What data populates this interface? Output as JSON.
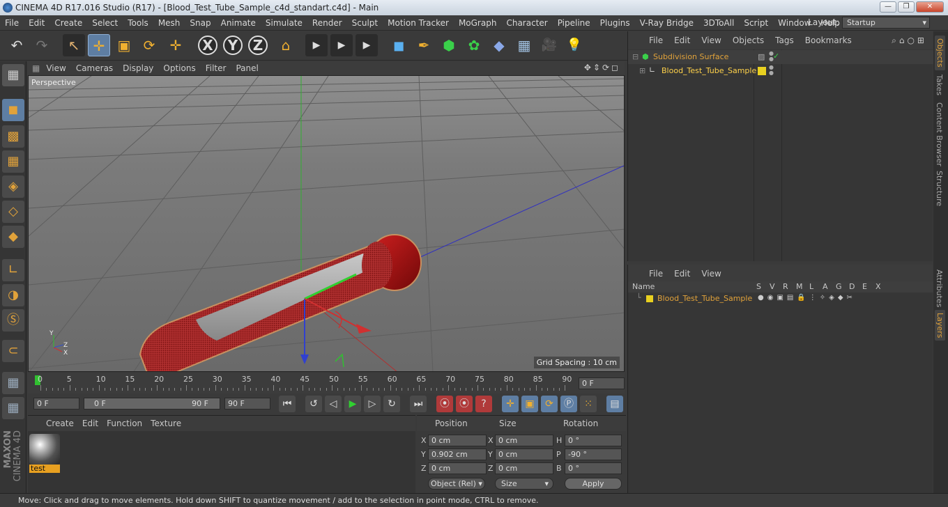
{
  "window": {
    "title": "CINEMA 4D R17.016 Studio (R17) - [Blood_Test_Tube_Sample_c4d_standart.c4d] - Main"
  },
  "menu": [
    "File",
    "Edit",
    "Create",
    "Select",
    "Tools",
    "Mesh",
    "Snap",
    "Animate",
    "Simulate",
    "Render",
    "Sculpt",
    "Motion Tracker",
    "MoGraph",
    "Character",
    "Pipeline",
    "Plugins",
    "V-Ray Bridge",
    "3DToAll",
    "Script",
    "Window",
    "Help"
  ],
  "layout": {
    "label": "Layout:",
    "value": "Startup"
  },
  "toolbar_icons": [
    "undo-icon",
    "redo-icon",
    "live-select-icon",
    "move-icon",
    "scale-icon",
    "rotate-icon",
    "transform-icon",
    "x-axis-lock",
    "y-axis-lock",
    "z-axis-lock",
    "world-coordinate-icon",
    "render-view-icon",
    "render-picture-viewer-icon",
    "edit-render-settings-icon",
    "cube-icon",
    "pen-icon",
    "subdivision-icon",
    "mograph-cloner-icon",
    "deformer-icon",
    "floor-icon",
    "camera-icon",
    "light-icon"
  ],
  "toolbar_glyphs": {
    "undo": "↶",
    "redo": "↷",
    "select": "↖",
    "move": "✛",
    "scale": "▣",
    "rotate": "⟳",
    "transform": "✛",
    "x": "X",
    "y": "Y",
    "z": "Z",
    "world": "⌂",
    "render1": "▶",
    "render2": "▶",
    "render3": "▶",
    "cube": "◼",
    "pen": "✒",
    "subdiv": "⬢",
    "cloner": "✿",
    "deformer": "◆",
    "floor": "▦",
    "camera": "🎥",
    "light": "💡"
  },
  "viewport": {
    "menu": [
      "View",
      "Cameras",
      "Display",
      "Options",
      "Filter",
      "Panel"
    ],
    "label": "Perspective",
    "grid_spacing": "Grid Spacing : 10 cm",
    "axis_labels": {
      "y": "Y",
      "z": "Z",
      "x": "X"
    }
  },
  "timeline": {
    "ticks": [
      "0",
      "5",
      "10",
      "15",
      "20",
      "25",
      "30",
      "35",
      "40",
      "45",
      "50",
      "55",
      "60",
      "65",
      "70",
      "75",
      "80",
      "85",
      "90"
    ],
    "current_frame": "0 F"
  },
  "transport": {
    "start": "0 F",
    "range_start": "0 F",
    "range_end": "90 F",
    "end": "90 F"
  },
  "material": {
    "menu": [
      "Create",
      "Edit",
      "Function",
      "Texture"
    ],
    "items": [
      {
        "name": "test"
      }
    ]
  },
  "coordinates": {
    "headers": {
      "position": "Position",
      "size": "Size",
      "rotation": "Rotation"
    },
    "rows": [
      {
        "axis": "X",
        "pos": "0 cm",
        "saxis": "X",
        "size": "0 cm",
        "raxis": "H",
        "rot": "0 °"
      },
      {
        "axis": "Y",
        "pos": "0.902 cm",
        "saxis": "Y",
        "size": "0 cm",
        "raxis": "P",
        "rot": "-90 °"
      },
      {
        "axis": "Z",
        "pos": "0 cm",
        "saxis": "Z",
        "size": "0 cm",
        "raxis": "B",
        "rot": "0 °"
      }
    ],
    "mode": "Object (Rel)",
    "size_mode": "Size",
    "apply": "Apply"
  },
  "objects": {
    "menu": [
      "File",
      "Edit",
      "View",
      "Objects",
      "Tags",
      "Bookmarks"
    ],
    "tree": [
      {
        "name": "Subdivision Surface",
        "color": "#e1a23a"
      },
      {
        "name": "Blood_Test_Tube_Sample",
        "color": "#ffd24a"
      }
    ]
  },
  "layers": {
    "menu": [
      "File",
      "Edit",
      "View"
    ],
    "columns": [
      "Name",
      "S",
      "V",
      "R",
      "M",
      "L",
      "A",
      "G",
      "D",
      "E",
      "X"
    ],
    "rows": [
      {
        "name": "Blood_Test_Tube_Sample",
        "color": "#e8d020"
      }
    ]
  },
  "side_tabs": [
    "Objects",
    "Takes",
    "Content Browser",
    "Structure",
    "Attributes",
    "Layers"
  ],
  "status": "Move: Click and drag to move elements. Hold down SHIFT to quantize movement / add to the selection in point mode, CTRL to remove.",
  "brand": {
    "maxon": "MAXON",
    "product": "CINEMA 4D"
  }
}
